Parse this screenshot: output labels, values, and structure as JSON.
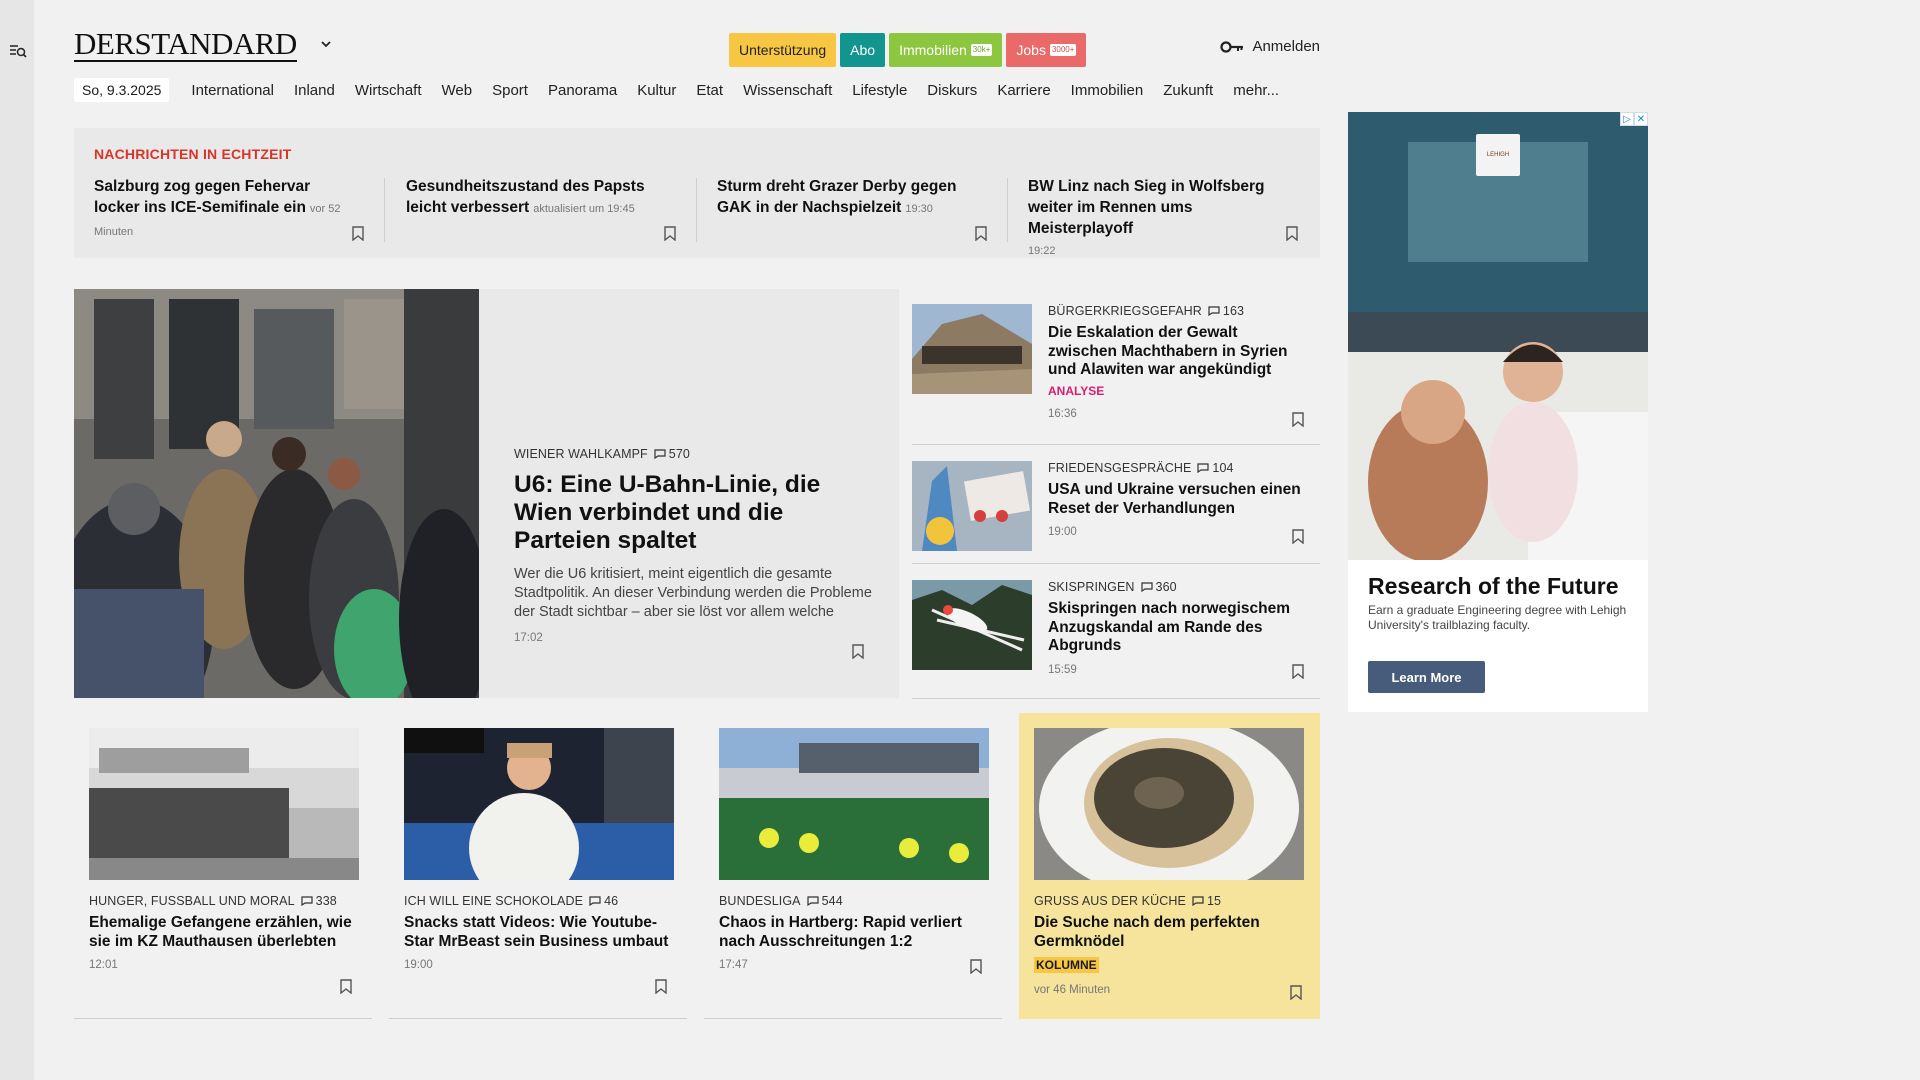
{
  "header": {
    "logo": "DERSTANDARD",
    "buttons": [
      {
        "label": "Unterstützung",
        "badge": ""
      },
      {
        "label": "Abo",
        "badge": ""
      },
      {
        "label": "Immobilien",
        "badge": "30k+"
      },
      {
        "label": "Jobs",
        "badge": "3000+"
      }
    ],
    "login": "Anmelden"
  },
  "nav": {
    "date": "So, 9.3.2025",
    "items": [
      "International",
      "Inland",
      "Wirtschaft",
      "Web",
      "Sport",
      "Panorama",
      "Kultur",
      "Etat",
      "Wissenschaft",
      "Lifestyle",
      "Diskurs",
      "Karriere",
      "Immobilien",
      "Zukunft",
      "mehr..."
    ]
  },
  "ticker": {
    "label": "NACHRICHTEN IN ECHTZEIT",
    "items": [
      {
        "title": "Salzburg zog gegen Fehervar locker ins ICE-Semifinale ein",
        "time": "vor 52 Minuten"
      },
      {
        "title": "Gesundheitszustand des Papsts leicht verbessert",
        "time": "aktualisiert um 19:45"
      },
      {
        "title": "Sturm dreht Grazer Derby gegen GAK in der Nachspielzeit",
        "time": "19:30"
      },
      {
        "title": "BW Linz nach Sieg in Wolfsberg weiter im Rennen ums Meisterplayoff",
        "time": "19:22"
      }
    ]
  },
  "lead": {
    "kicker": "WIENER WAHLKAMPF",
    "comments": "570",
    "title": "U6: Eine U-Bahn-Linie, die Wien verbindet und die Parteien spaltet",
    "teaser": "Wer die U6 kritisiert, meint eigentlich die gesamte Stadtpolitik. An dieser Verbindung werden die Probleme der Stadt sichtbar – aber sie löst vor allem welche",
    "time": "17:02"
  },
  "side": [
    {
      "kicker": "BÜRGERKRIEGSGEFAHR",
      "comments": "163",
      "title": "Die Eskalation der Gewalt zwischen Machthabern in Syrien und Alawiten war angekündigt",
      "label": "ANALYSE",
      "time": "16:36"
    },
    {
      "kicker": "FRIEDENSGESPRÄCHE",
      "comments": "104",
      "title": "USA und Ukraine versuchen einen Reset der Verhandlungen",
      "label": "",
      "time": "19:00"
    },
    {
      "kicker": "SKISPRINGEN",
      "comments": "360",
      "title": "Skispringen nach norwegischem Anzugskandal am Rande des Abgrunds",
      "label": "",
      "time": "15:59"
    }
  ],
  "cards": [
    {
      "kicker": "HUNGER, FUSSBALL UND MORAL",
      "comments": "338",
      "title": "Ehemalige Gefangene erzählen, wie sie im KZ Mauthausen überlebten",
      "label": "",
      "time": "12:01"
    },
    {
      "kicker": "ICH WILL EINE SCHOKOLADE",
      "comments": "46",
      "title": "Snacks statt Videos: Wie Youtube-Star MrBeast sein Business umbaut",
      "label": "",
      "time": "19:00"
    },
    {
      "kicker": "BUNDESLIGA",
      "comments": "544",
      "title": "Chaos in Hartberg: Rapid verliert nach Ausschreitungen 1:2",
      "label": "",
      "time": "17:47"
    },
    {
      "kicker": "GRUSS AUS DER KÜCHE",
      "comments": "15",
      "title": "Die Suche nach dem perfekten Germknödel",
      "label": "KOLUMNE",
      "time": "vor 46 Minuten"
    }
  ],
  "ad": {
    "title": "Research of the Future",
    "text": "Earn a graduate Engineering degree with Lehigh University's trailblazing faculty.",
    "button": "Learn More",
    "sign": "LEHIGH"
  },
  "colors": {
    "ticker_label": "#d8352a",
    "analyse": "#d6206f",
    "kolumne_bg": "#f6e39c"
  }
}
